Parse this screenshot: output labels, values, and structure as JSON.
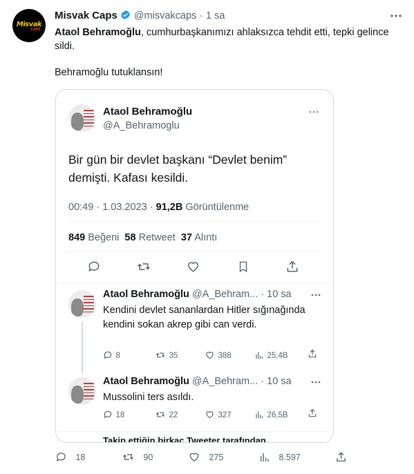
{
  "post": {
    "author_name": "Misvak Caps",
    "author_handle": "@misvakcaps",
    "separator": "·",
    "time": "1 sa",
    "avatar_logo": "Misvak",
    "avatar_logo_sub": "CAPS",
    "text_bold": "Ataol Behramoğlu",
    "text_rest": ", cumhurbaşkanımızı ahlaksızca tehdit etti, tepki gelince sildi.",
    "text_second": "Behramoğlu tutuklansın!",
    "actions": {
      "replies": "18",
      "retweets": "90",
      "likes": "275",
      "views": "8.597"
    }
  },
  "quoted": {
    "author_name": "Ataol Behramoğlu",
    "author_handle": "@A_Behramoglu",
    "text": "Bir gün bir devlet başkanı “Devlet benim” demişti. Kafası kesildi.",
    "time": "00:49",
    "date": "1.03.2023",
    "views_count": "91,2B",
    "views_label": "Görüntülenme",
    "likes_count": "849",
    "likes_label": "Beğeni",
    "retweets_count": "58",
    "retweets_label": "Retweet",
    "quotes_count": "37",
    "quotes_label": "Alıntı"
  },
  "replies": [
    {
      "author_name": "Ataol Behramoğlu",
      "author_handle": "@A_Behram...",
      "time": "10 sa",
      "text": "Kendini devlet sananlardan Hitler sığınağında kendini sokan akrep gibi can verdi.",
      "replies": "8",
      "retweets": "35",
      "likes": "388",
      "views": "25,4B"
    },
    {
      "author_name": "Ataol Behramoğlu",
      "author_handle": "@A_Behram...",
      "time": "10 sa",
      "text": "Mussolini ters asıldı.",
      "replies": "18",
      "retweets": "22",
      "likes": "327",
      "views": "26,5B"
    }
  ],
  "footer_cut": "Takip ettiğin birkaç Tweeter tarafından",
  "colors": {
    "verified": "#1d9bf0",
    "muted": "#536471",
    "border": "#cfd9de"
  }
}
